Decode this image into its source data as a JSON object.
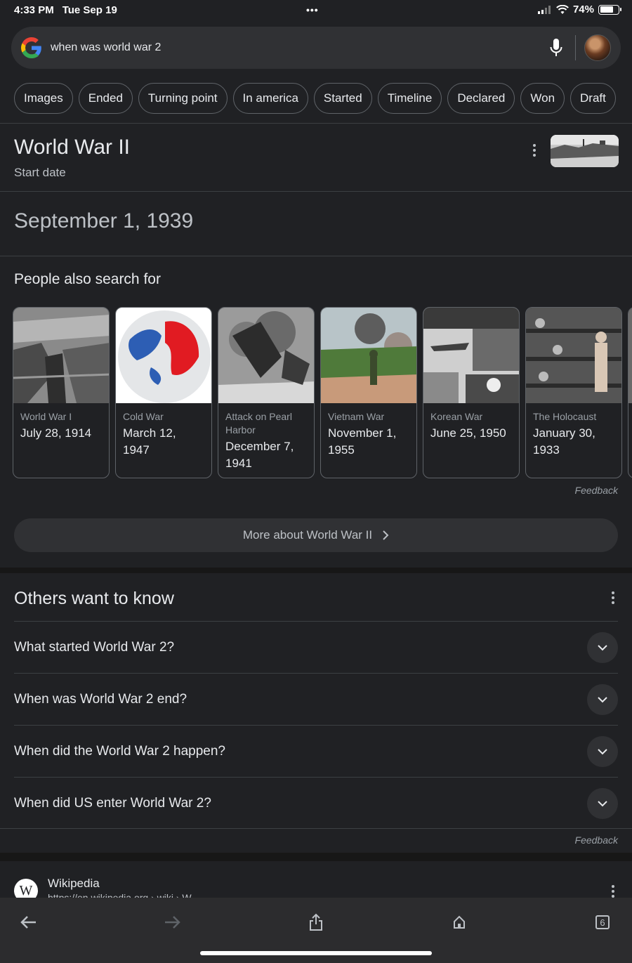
{
  "status_bar": {
    "time": "4:33 PM",
    "date": "Tue Sep 19",
    "battery": "74%",
    "battery_level": 0.74
  },
  "search": {
    "query": "when was world war 2"
  },
  "chips": [
    "Images",
    "Ended",
    "Turning point",
    "In america",
    "Started",
    "Timeline",
    "Declared",
    "Won",
    "Draft"
  ],
  "knowledge_panel": {
    "title": "World War II",
    "subtitle": "Start date",
    "answer": "September 1, 1939"
  },
  "people_also_search": {
    "heading": "People also search for",
    "cards": [
      {
        "name": "World War I",
        "date": "July 28, 1914"
      },
      {
        "name": "Cold War",
        "date": "March 12, 1947"
      },
      {
        "name": "Attack on Pearl Harbor",
        "date": "December 7, 1941"
      },
      {
        "name": "Vietnam War",
        "date": "November 1, 1955"
      },
      {
        "name": "Korean War",
        "date": "June 25, 1950"
      },
      {
        "name": "The Holocaust",
        "date": "January 30, 1933"
      }
    ],
    "feedback": "Feedback"
  },
  "more_button": {
    "label": "More about World War II"
  },
  "others_want_to_know": {
    "heading": "Others want to know",
    "questions": [
      "What started World War 2?",
      "When was World War 2 end?",
      "When did the World War 2 happen?",
      "When did US enter World War 2?"
    ],
    "feedback": "Feedback"
  },
  "result": {
    "site": "Wikipedia",
    "url": "https://en.wikipedia.org › wiki › W...",
    "logo_letter": "W"
  },
  "toolbar": {
    "tab_count": "6"
  }
}
